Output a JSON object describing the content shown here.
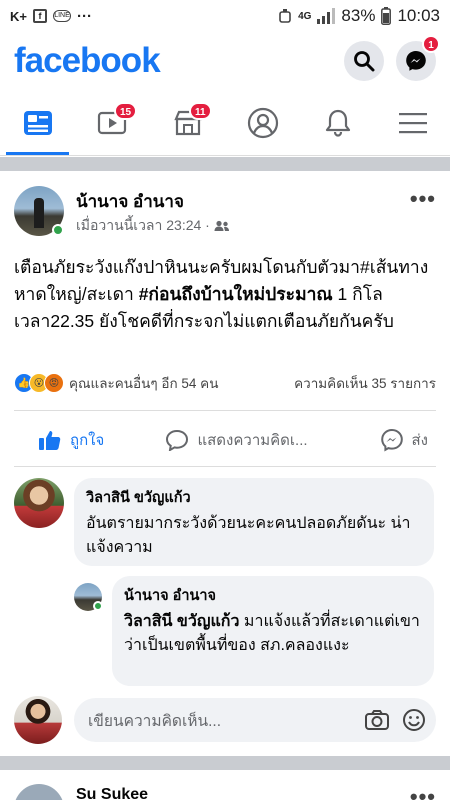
{
  "status_bar": {
    "left_items": [
      "K+",
      "f",
      "LINE",
      "···"
    ],
    "network": "4G",
    "battery": "83%",
    "time": "10:03"
  },
  "header": {
    "logo": "facebook",
    "messenger_badge": "1"
  },
  "nav": {
    "tabs": [
      {
        "name": "home",
        "badge": ""
      },
      {
        "name": "watch",
        "badge": "15"
      },
      {
        "name": "marketplace",
        "badge": "11"
      },
      {
        "name": "profile",
        "badge": ""
      },
      {
        "name": "notifications",
        "badge": ""
      },
      {
        "name": "menu",
        "badge": ""
      }
    ],
    "active": "home"
  },
  "post": {
    "author": "น้านาจ อำนาจ",
    "timestamp": "เมื่อวานนี้เวลา 23:24 ·",
    "text_1": "เตือนภัยระวังแก๊งปาหินนะครับผมโดนกับตัวมา",
    "text_tag_1": "#เส้นทาง",
    "text_2": " หาดใหญ่/สะเดา ",
    "text_tag_2": "#ก่อนถึงบ้านใหม่ประมาณ",
    "text_3": " 1 กิโลเวลา22.35 ยังโชคดีที่กระจกไม่แตกเตือนภัยกันครับ",
    "reactions_text": "คุณและคนอื่นๆ อีก 54 คน",
    "comments_count": "ความคิดเห็น 35 รายการ",
    "actions": {
      "like": "ถูกใจ",
      "comment": "แสดงความคิดเ...",
      "share": "ส่ง"
    }
  },
  "comments": [
    {
      "name": "วิลาสินี ขวัญแก้ว",
      "text": "อันตรายมากระวังด้วยนะคะคนปลอดภัยดันะ น่าแจ้งความ"
    },
    {
      "name": "น้านาจ อำนาจ",
      "mention": "วิลาสินี ขวัญแก้ว",
      "text": " มาแจ้งแล้วที่สะเดาแต่เขาว่าเป็นเขตพื้นที่ของ สภ.คลองแงะ"
    }
  ],
  "write_comment": {
    "placeholder": "เขียนความคิดเห็น..."
  },
  "next_post": {
    "author": "Su Sukee"
  },
  "colors": {
    "brand": "#1877f2",
    "badge": "#e41e3f",
    "bubble": "#f0f2f5",
    "online": "#31a24c"
  }
}
